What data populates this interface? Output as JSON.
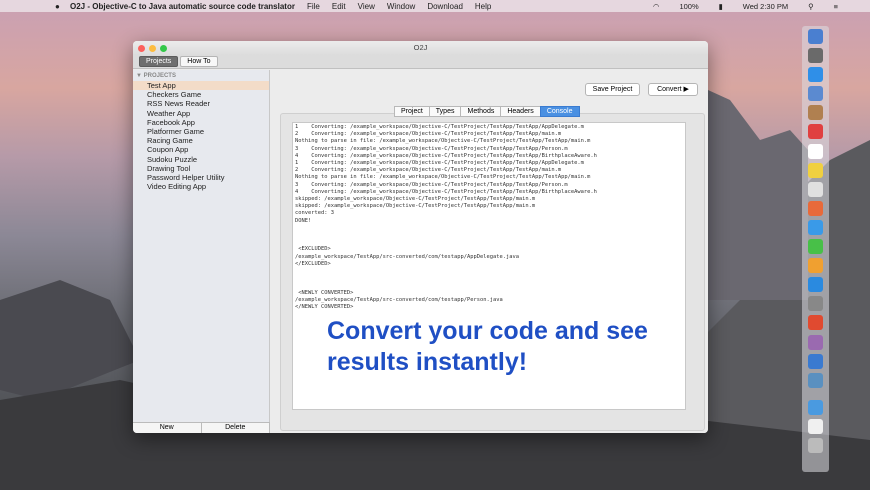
{
  "menubar": {
    "app": "O2J - Objective-C to Java automatic source code translator",
    "items": [
      "File",
      "Edit",
      "View",
      "Window",
      "Download",
      "Help"
    ],
    "battery": "100%",
    "clock": "Wed 2:30 PM"
  },
  "window": {
    "title": "O2J",
    "toolbar_tabs": [
      "Projects",
      "How To"
    ]
  },
  "sidebar": {
    "section": "PROJECTS",
    "items": [
      "Test App",
      "Checkers Game",
      "RSS News Reader",
      "Weather App",
      "Facebook App",
      "Platformer Game",
      "Racing Game",
      "Coupon App",
      "Sudoku Puzzle",
      "Drawing Tool",
      "Password Helper Utility",
      "Video Editing App"
    ],
    "new_label": "New",
    "delete_label": "Delete"
  },
  "main": {
    "save_label": "Save Project",
    "convert_label": "Convert ▶",
    "tabs": [
      "Project",
      "Types",
      "Methods",
      "Headers",
      "Console"
    ],
    "active_tab": "Console",
    "console": "1    Converting: /example_workspace/Objective-C/TestProject/TestApp/TestApp/AppDelegate.m\n2    Converting: /example_workspace/Objective-C/TestProject/TestApp/TestApp/main.m\nNothing to parse in file: /example_workspace/Objective-C/TestProject/TestApp/TestApp/main.m\n3    Converting: /example_workspace/Objective-C/TestProject/TestApp/TestApp/Person.m\n4    Converting: /example_workspace/Objective-C/TestProject/TestApp/TestApp/BirthplaceAware.h\n1    Converting: /example_workspace/Objective-C/TestProject/TestApp/TestApp/AppDelegate.m\n2    Converting: /example_workspace/Objective-C/TestProject/TestApp/TestApp/main.m\nNothing to parse in file: /example_workspace/Objective-C/TestProject/TestApp/TestApp/main.m\n3    Converting: /example_workspace/Objective-C/TestProject/TestApp/TestApp/Person.m\n4    Converting: /example_workspace/Objective-C/TestProject/TestApp/TestApp/BirthplaceAware.h\nskipped: /example_workspace/Objective-C/TestProject/TestApp/TestApp/main.m\nskipped: /example_workspace/Objective-C/TestProject/TestApp/TestApp/main.m\nconverted: 3\nDONE!\n\n\n\n <EXCLUDED>\n/example_workspace/TestApp/src-converted/com/testapp/AppDelegate.java\n</EXCLUDED>\n\n\n\n <NEWLY CONVERTED>\n/example_workspace/TestApp/src-converted/com/testapp/Person.java\n</NEWLY CONVERTED>"
  },
  "overlay": {
    "line1": "Convert your code and see",
    "line2": "results instantly!"
  },
  "dock_colors": [
    "#4a7fd0",
    "#6a6a6a",
    "#2f8fe8",
    "#5b8ad0",
    "#b08050",
    "#e04040",
    "#ffffff",
    "#f0d040",
    "#e0e0e0",
    "#e86a3a",
    "#3a9ae8",
    "#48c048",
    "#f0a030",
    "#2a8ae0",
    "#888888",
    "#e04a30",
    "#9a6ab0",
    "#3a7ad0",
    "#5a90c0",
    "#4a9ae0",
    "#f0f0f0",
    "#bbbbbb"
  ]
}
